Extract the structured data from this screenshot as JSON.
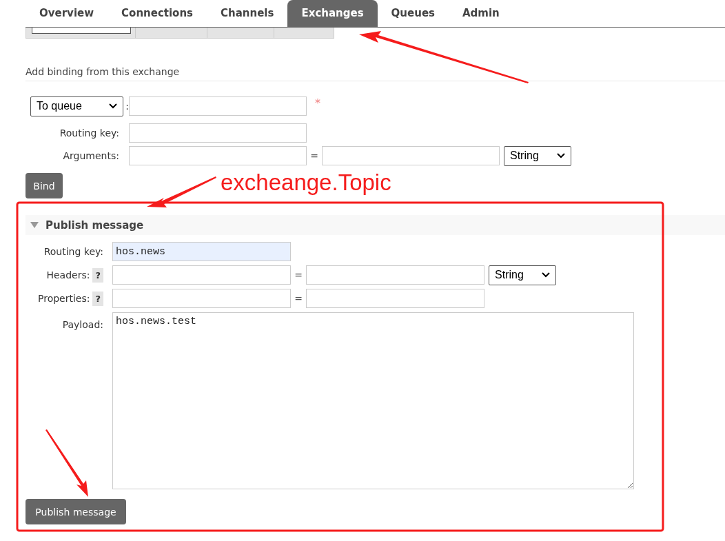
{
  "tabs": [
    {
      "label": "Overview",
      "selected": false
    },
    {
      "label": "Connections",
      "selected": false
    },
    {
      "label": "Channels",
      "selected": false
    },
    {
      "label": "Exchanges",
      "selected": true
    },
    {
      "label": "Queues",
      "selected": false
    },
    {
      "label": "Admin",
      "selected": false
    }
  ],
  "binding": {
    "heading": "Add binding from this exchange",
    "destination": {
      "select": "To queue",
      "separator": ":",
      "required_mark": "*"
    },
    "routing_key": {
      "label": "Routing key:"
    },
    "arguments": {
      "label": "Arguments:",
      "equals": "=",
      "type": "String"
    },
    "button": "Bind"
  },
  "publish": {
    "heading": "Publish message",
    "expanded": true,
    "routing_key": {
      "label": "Routing key:",
      "value": "hos.news"
    },
    "headers": {
      "label": "Headers:",
      "help": "?",
      "equals": "=",
      "type": "String"
    },
    "properties": {
      "label": "Properties:",
      "help": "?",
      "equals": "="
    },
    "payload": {
      "label": "Payload:",
      "value": "hos.news.test"
    },
    "button": "Publish message"
  },
  "annotation": {
    "text": "excheange.Topic"
  }
}
